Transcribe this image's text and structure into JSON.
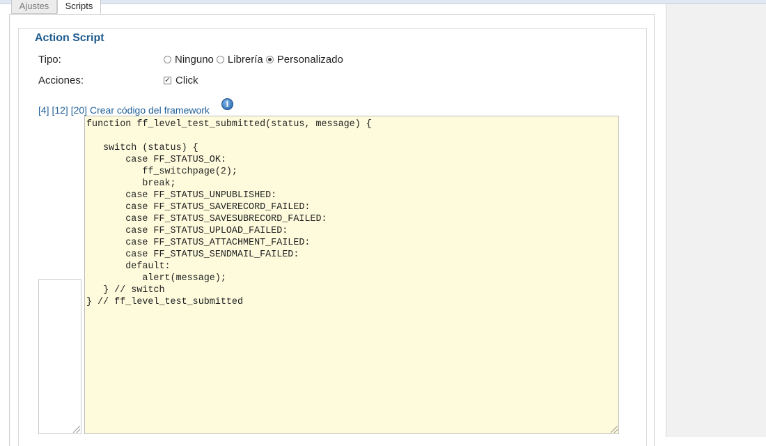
{
  "tabs": [
    {
      "label": "Ajustes",
      "active": false
    },
    {
      "label": "Scripts",
      "active": true
    }
  ],
  "section": {
    "title": "Action Script"
  },
  "form": {
    "tipo": {
      "label": "Tipo:",
      "options": [
        "Ninguno",
        "Librería",
        "Personalizado"
      ],
      "selected": "Personalizado"
    },
    "acciones": {
      "label": "Acciones:",
      "checkbox_label": "Click",
      "checked": true
    }
  },
  "links": {
    "l4": "[4]",
    "l12": "[12]",
    "l20": "[20]",
    "create": "Crear código del framework"
  },
  "info_icon": {
    "glyph": "i",
    "icon": "info-icon"
  },
  "code": "function ff_level_test_submitted(status, message) {\n\n   switch (status) {\n       case FF_STATUS_OK:\n          ff_switchpage(2);\n          break;\n       case FF_STATUS_UNPUBLISHED:\n       case FF_STATUS_SAVERECORD_FAILED:\n       case FF_STATUS_SAVESUBRECORD_FAILED:\n       case FF_STATUS_UPLOAD_FAILED:\n       case FF_STATUS_ATTACHMENT_FAILED:\n       case FF_STATUS_SENDMAIL_FAILED:\n       default:\n          alert(message);\n   } // switch\n} // ff_level_test_submitted",
  "colors": {
    "accent": "#1e5b8e",
    "link": "#1f5f99",
    "code_bg": "#fdfbdc"
  }
}
